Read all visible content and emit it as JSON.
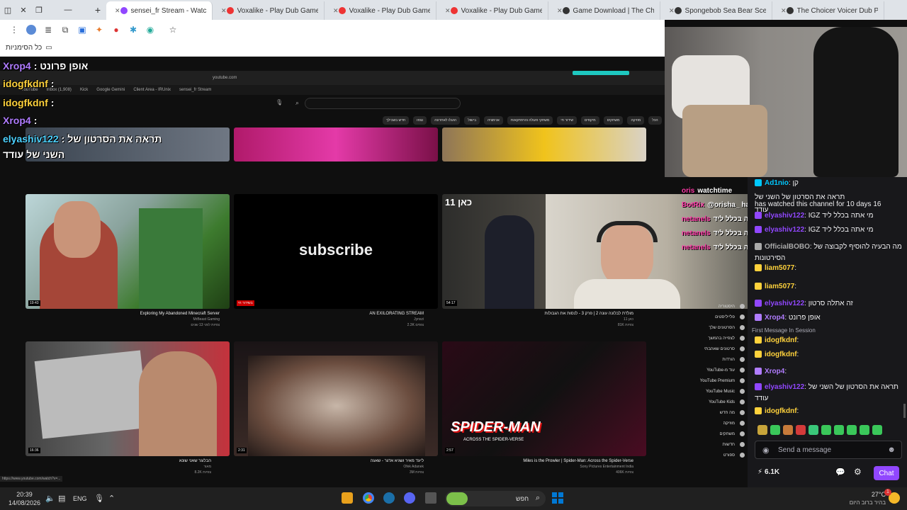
{
  "tabs": [
    {
      "title": "sensei_fr Stream - Watch Li",
      "active": true,
      "color": "#9147ff"
    },
    {
      "title": "Voxalike - Play Dub Game O",
      "active": false,
      "color": "#e33"
    },
    {
      "title": "Voxalike - Play Dub Game O",
      "active": false,
      "color": "#e33"
    },
    {
      "title": "Voxalike - Play Dub Game Onli",
      "active": false,
      "color": "#e33"
    },
    {
      "title": "Game Download | The Choicer",
      "active": false,
      "color": "#333"
    },
    {
      "title": "Spongebob Sea Bear Scene Du",
      "active": false,
      "color": "#333"
    },
    {
      "title": "The Choicer Voicer Dub Packs |",
      "active": false,
      "color": "#333"
    }
  ],
  "new_tab_label": "+",
  "bookmarks_label": "כל הסימניות",
  "overlay_chat": [
    {
      "user": "Xrop4",
      "text": ": אופן פרונט",
      "color": "#b07cff"
    },
    {
      "user": "idogfkdnf",
      "text": ":",
      "color": "#ffd23c"
    },
    {
      "user": "idogfkdnf",
      "text": ":",
      "color": "#ffd23c"
    },
    {
      "user": "Xrop4",
      "text": ":",
      "color": "#b07cff"
    },
    {
      "user": "elyashiv122",
      "text": ": תראה את הסרטון של",
      "color": "#4dd2ff"
    },
    {
      "user": "",
      "text": "השני של עודד",
      "color": "#ffffff"
    }
  ],
  "inner": {
    "url": "youtube.com",
    "bookmarks": [
      "YouTube",
      "Inbox (1,908)",
      "Kick",
      "Google Gemini",
      "Client Area - IRUnix",
      "sensei_fr Stream"
    ],
    "chips": [
      "הכל",
      "מוזיקה",
      "משחקים",
      "מיקסים",
      "שידור חי",
      "משחקי פעולה והרפתקאות",
      "אנימציה",
      "בישול",
      "הועלו לאחרונה",
      "נצפו",
      "חדש בשבילך"
    ]
  },
  "videos": [
    {
      "title": "Exploring My Abandoned Minecraft Server",
      "channel": "MrBeast Gaming",
      "stats": "צפיות לפני 13 שנים",
      "duration": "19:43"
    },
    {
      "title": "AN EXILORATING STREAM",
      "channel": "Jynxzi",
      "stats": "2.3K צופים",
      "duration": "בשידור חי"
    },
    {
      "title": "מולדת לבלונה עונה 2 | פרק 3 - לנסות את הגבולות",
      "channel": "כאן 11",
      "stats": "81K צפיות",
      "duration": "54:17"
    },
    {
      "title": "הבלוגר שאני שונא",
      "channel": "מאור",
      "stats": "8.2K צפיות",
      "duration": "16:36"
    },
    {
      "title": "ליעד מאיר ושגיא אדגר - שאגה",
      "channel": "Ofek Adanek",
      "stats": "3M צפיות",
      "duration": "2:31"
    },
    {
      "title": "Miles is the Prowler | Spider-Man: Across the Spider-Verse",
      "channel": "Sony Pictures Entertainment India",
      "stats": "406K צפיות",
      "duration": "2:57"
    }
  ],
  "subscribe_text": "subscribe",
  "spiderman_text": "SPIDER-MAN",
  "spiderman_sub": "ACROSS THE SPIDER-VERSE",
  "kan_logo": "כאן 11",
  "sidebar": [
    "היסטוריה",
    "פלייליסטים",
    "הסרטונים שלך",
    "לצפייה בהמשך",
    "סרטונים שאהבתי",
    "הורדות",
    "YouTube-עוד מ",
    "YouTube Premium",
    "YouTube Music",
    "YouTube Kids",
    "מה חדש",
    "מוזיקה",
    "משחקים",
    "חדשות",
    "ספורט"
  ],
  "chat": {
    "messages": [
      {
        "user": "Ad1nio",
        "text": "קן",
        "color": "#00c8ff"
      },
      {
        "user": "",
        "text": "תראה את הסרטון של השני של",
        "color": "#efeff1"
      },
      {
        "user": "",
        "text": "has watched this channel for 10 days 16",
        "color": "#efeff1"
      },
      {
        "user": "",
        "text": "עודד",
        "color": "#efeff1"
      },
      {
        "user": "elyashiv122",
        "text": "IGZ מי אתה בכלל ליד",
        "color": "#9147ff"
      },
      {
        "user": "elyashiv122",
        "text": "IGZ מי אתה בכלל ליד",
        "color": "#9147ff"
      },
      {
        "user": "OfficialBOBO",
        "text": "מה הבעיה להוסיף לקבוצה של",
        "color": "#aaaaaa"
      },
      {
        "user": "",
        "text": "הסירטונות",
        "color": "#efeff1"
      },
      {
        "user": "liam5077",
        "text": "",
        "color": "#ffd23c"
      },
      {
        "user": "liam5077",
        "text": "",
        "color": "#ffd23c"
      },
      {
        "user": "elyashiv122",
        "text": "זה אתלה סרטון",
        "color": "#9147ff"
      },
      {
        "user": "Xrop4",
        "text": "אופן פרונט",
        "color": "#b07cff"
      },
      {
        "user": "idogfkdnf",
        "text": "",
        "color": "#ffd23c"
      },
      {
        "user": "idogfkdnf",
        "text": "",
        "color": "#ffd23c"
      },
      {
        "user": "Xrop4",
        "text": "",
        "color": "#b07cff"
      },
      {
        "user": "elyashiv122",
        "text": "תראה את הסרטון של השני של",
        "color": "#9147ff"
      },
      {
        "user": "",
        "text": "עודד",
        "color": "#efeff1"
      },
      {
        "user": "idogfkdnf",
        "text": "",
        "color": "#ffd23c"
      }
    ],
    "first_message_label": "First Message In Session",
    "send_placeholder": "Send a message",
    "viewers": "6.1K",
    "chat_button": "Chat"
  },
  "overlay_left_chat": [
    {
      "user": "netanels",
      "text": "מי אתה בכלל ליד IGZ"
    },
    {
      "user": "netanels",
      "text": "מי אתה בכלל ליד IGZ"
    },
    {
      "user": "netanels",
      "text": "מי אתה בכלל ליד IGZ"
    },
    {
      "user": "BotRix",
      "text": "@orisha_ has watched this channel"
    },
    {
      "user": "oris",
      "text": "watchtime"
    }
  ],
  "taskbar": {
    "time": "20:39",
    "date": "14/08/2026",
    "lang": "ENG",
    "search": "חפש",
    "temp": "27°C",
    "weather": "בהיר ברוב היום",
    "notif": "1"
  },
  "status_url": "https://www.youtube.com/watch?v=..."
}
